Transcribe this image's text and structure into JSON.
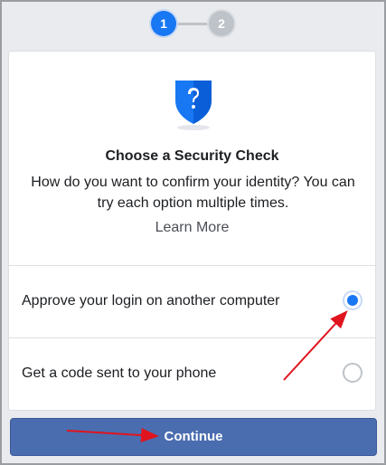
{
  "stepper": {
    "step1": "1",
    "step2": "2",
    "current": 1
  },
  "card": {
    "title": "Choose a Security Check",
    "description": "How do you want to confirm your identity? You can try each option multiple times.",
    "learn_more": "Learn More",
    "icon": "shield-question-icon"
  },
  "options": [
    {
      "label": "Approve your login on another computer",
      "selected": true
    },
    {
      "label": "Get a code sent to your phone",
      "selected": false
    }
  ],
  "continue_label": "Continue",
  "colors": {
    "accent": "#1877f2",
    "button": "#4a6db0",
    "annotation": "#e0141e"
  }
}
